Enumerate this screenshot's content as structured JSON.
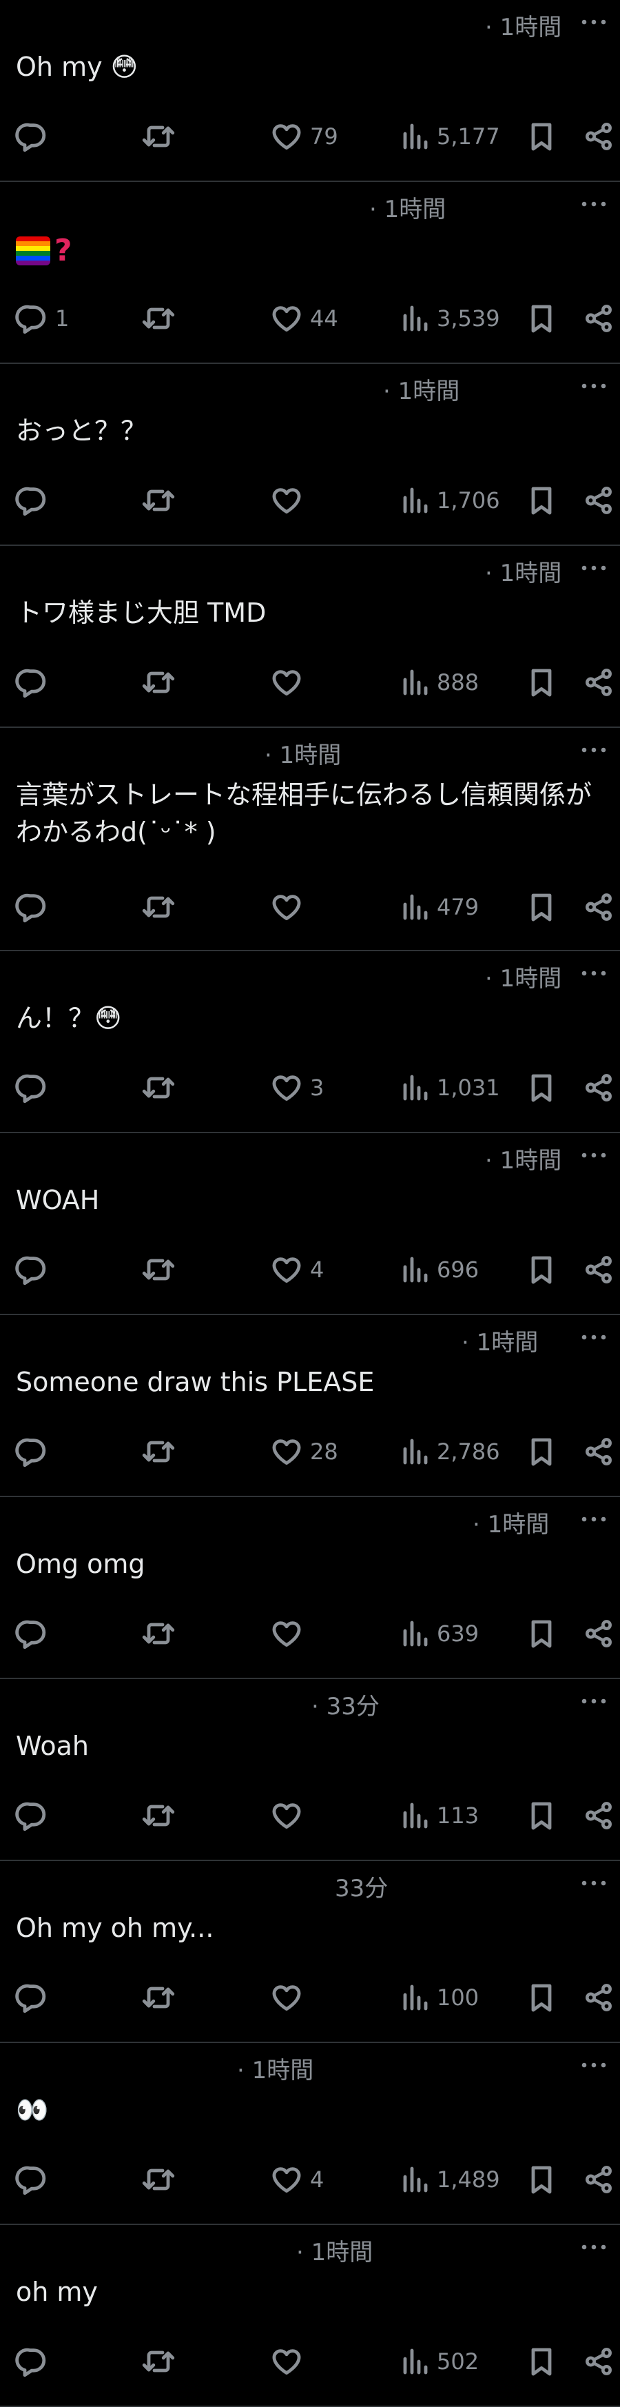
{
  "colors": {
    "background": "#000000",
    "text": "#e7e9ea",
    "secondary": "#8b9096",
    "divider": "#2f3336"
  },
  "icons": {
    "reply": "reply-icon",
    "retweet": "retweet-icon",
    "like": "heart-icon",
    "views": "views-icon",
    "bookmark": "bookmark-icon",
    "share": "share-icon",
    "more": "more-icon"
  },
  "posts": [
    {
      "time": "· 1時間",
      "text": "Oh my 😳",
      "replies": "",
      "likes": "79",
      "views": "5,177"
    },
    {
      "time": "· 1時間",
      "text": "",
      "rich": "flag-question",
      "replies": "1",
      "likes": "44",
      "views": "3,539"
    },
    {
      "time": "· 1時間",
      "text": "おっと？？",
      "replies": "",
      "likes": "",
      "views": "1,706"
    },
    {
      "time": "· 1時間",
      "text": "トワ様まじ大胆 TMD",
      "replies": "",
      "likes": "",
      "views": "888"
    },
    {
      "time": "· 1時間",
      "text": "言葉がストレートな程相手に伝わるし信頼関係がわかるわd(˙ᵕ˙* )",
      "replies": "",
      "likes": "",
      "views": "479"
    },
    {
      "time": "· 1時間",
      "text": "ん！？😳",
      "replies": "",
      "likes": "3",
      "views": "1,031"
    },
    {
      "time": "· 1時間",
      "text": "WOAH",
      "replies": "",
      "likes": "4",
      "views": "696"
    },
    {
      "time": "· 1時間",
      "text": "Someone draw this PLEASE",
      "replies": "",
      "likes": "28",
      "views": "2,786"
    },
    {
      "time": "· 1時間",
      "text": "Omg omg",
      "replies": "",
      "likes": "",
      "views": "639"
    },
    {
      "time": "· 33分",
      "text": "Woah",
      "replies": "",
      "likes": "",
      "views": "113"
    },
    {
      "time": "33分",
      "text": "Oh my oh my...",
      "replies": "",
      "likes": "",
      "views": "100"
    },
    {
      "time": "· 1時間",
      "text": "👀",
      "replies": "",
      "likes": "4",
      "views": "1,489"
    },
    {
      "time": "· 1時間",
      "text": "oh my",
      "replies": "",
      "likes": "",
      "views": "502"
    }
  ]
}
